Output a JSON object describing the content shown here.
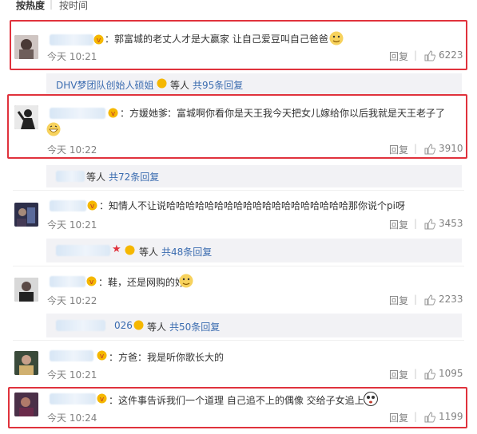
{
  "sort": {
    "active": "按热度",
    "other": "按时间"
  },
  "comments": [
    {
      "text": "：郭富城的老丈人才是大赢家  让自己爱豆叫自己爸爸",
      "time": "今天 10:21",
      "reply": "回复",
      "likes": "6223"
    },
    {
      "name": "方媛她爹",
      "text": "：富城啊你看你是天王我今天把女儿嫁给你以后我就是天王老子了",
      "time": "今天 10:22",
      "reply": "回复",
      "likes": "3910"
    },
    {
      "text": "：知情人不让说哈哈哈哈哈哈哈哈哈哈哈哈哈哈哈哈哈哈哈那你说个pi呀",
      "time": "今天 10:21",
      "reply": "回复",
      "likes": "3453"
    },
    {
      "text": "：鞋，还是网购的好",
      "time": "今天 10:22",
      "reply": "回复",
      "likes": "2233"
    },
    {
      "text": "：方爸：我是听你歌长大的",
      "time": "今天 10:21",
      "reply": "回复",
      "likes": "1095"
    },
    {
      "text": "：这件事告诉我们一个道理 自己追不上的偶像 交给子女追上",
      "time": "今天 10:24",
      "reply": "回复",
      "likes": "1199"
    }
  ],
  "subreplies": [
    {
      "prefix": "DHV梦团队创始人硕姐",
      "suffix": "等人",
      "count": "共95条回复"
    },
    {
      "prefix": "",
      "suffix": "等人",
      "count": "共72条回复"
    },
    {
      "prefix": "",
      "suffix": "等人",
      "count": "共48条回复"
    },
    {
      "prefix": "026",
      "suffix": "等人",
      "count": "共50条回复"
    }
  ],
  "icons": {
    "like": "thumbs-up-icon",
    "vip": "vip-badge-icon",
    "emoji": "doge-emoji-icon"
  },
  "colors": {
    "highlight": "#e0323c",
    "link": "#3b6cb0",
    "meta": "#808080",
    "subreply_bg": "#f2f2f5"
  }
}
